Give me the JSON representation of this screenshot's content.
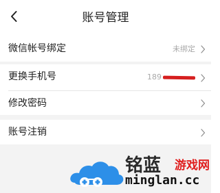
{
  "header": {
    "title": "账号管理",
    "back_icon": "chevron-left-icon"
  },
  "rows": [
    {
      "label": "微信帐号绑定",
      "value": "未绑定",
      "icon": "chevron-right-icon"
    },
    {
      "label": "更换手机号",
      "value_prefix": "189",
      "icon": "chevron-right-icon"
    },
    {
      "label": "修改密码",
      "icon": "chevron-right-icon"
    },
    {
      "label": "账号注销",
      "icon": "chevron-right-icon"
    }
  ],
  "watermark": {
    "chinese": "铭蓝",
    "subtitle": "游戏网",
    "english": "minglan.cc",
    "logo_icon": "cloud-gamepad-icon"
  },
  "colors": {
    "page_bg": "#ffffff",
    "section_gap": "#f3f3f3",
    "redaction": "#d61f1f",
    "watermark_blue": "#2d8fe8",
    "watermark_red": "#e01e1e"
  }
}
